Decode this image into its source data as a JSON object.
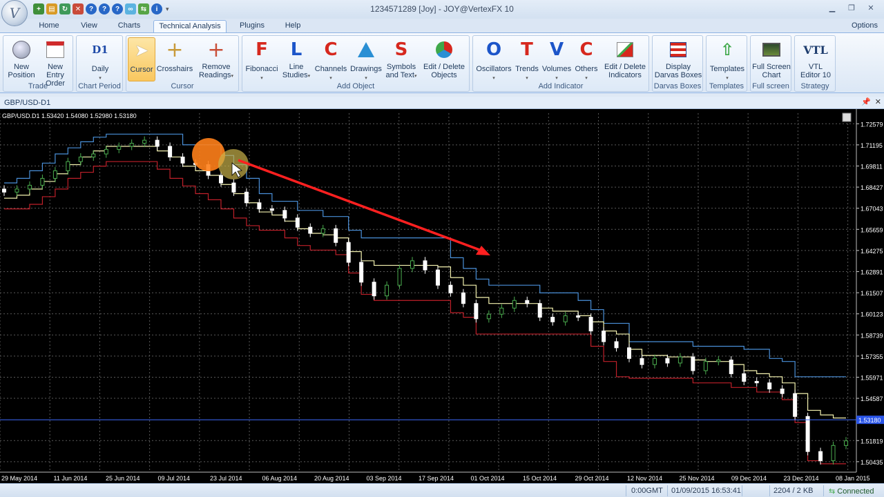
{
  "window": {
    "title": "1234571289 [Joy] - JOY@VertexFX 10",
    "logo_letter": "V",
    "quick_access": [
      "new-icon",
      "open-icon",
      "refresh-icon",
      "tools-icon",
      "help-icon",
      "help-icon",
      "help-icon",
      "link-icon",
      "connection-icon",
      "info-icon"
    ],
    "dropdown": "▾"
  },
  "menu": {
    "tabs": [
      {
        "label": "Home"
      },
      {
        "label": "View"
      },
      {
        "label": "Charts"
      },
      {
        "label": "Technical Analysis"
      },
      {
        "label": "Plugins"
      },
      {
        "label": "Help"
      }
    ],
    "options": "Options"
  },
  "ribbon": {
    "groups": [
      {
        "label": "Trade",
        "buttons": [
          {
            "l1": "New",
            "l2": "Position",
            "icon": "new-position-icon"
          },
          {
            "l1": "New Entry",
            "l2": "Order",
            "icon": "new-entry-order-icon"
          }
        ]
      },
      {
        "label": "Chart Period",
        "buttons": [
          {
            "l1": "Daily",
            "l2": "",
            "glyph": "D1",
            "icon": "daily-period-icon"
          }
        ]
      },
      {
        "label": "Cursor",
        "buttons": [
          {
            "l1": "Cursor",
            "l2": "",
            "icon": "cursor-icon"
          },
          {
            "l1": "Crosshairs",
            "l2": "",
            "icon": "crosshairs-icon"
          },
          {
            "l1": "Remove",
            "l2": "Readings",
            "icon": "remove-readings-icon"
          }
        ]
      },
      {
        "label": "Add Object",
        "buttons": [
          {
            "l1": "Fibonacci",
            "l2": "",
            "glyph": "F",
            "icon": "fibonacci-icon"
          },
          {
            "l1": "Line",
            "l2": "Studies",
            "glyph": "L",
            "icon": "line-studies-icon"
          },
          {
            "l1": "Channels",
            "l2": "",
            "glyph": "C",
            "icon": "channels-icon"
          },
          {
            "l1": "Drawings",
            "l2": "",
            "icon": "drawings-icon"
          },
          {
            "l1": "Symbols",
            "l2": "and Text",
            "glyph": "S",
            "icon": "symbols-text-icon"
          },
          {
            "l1": "Edit / Delete",
            "l2": "Objects",
            "icon": "edit-objects-icon"
          }
        ]
      },
      {
        "label": "Add Indicator",
        "buttons": [
          {
            "l1": "Oscillators",
            "l2": "",
            "glyph": "O",
            "icon": "oscillators-icon"
          },
          {
            "l1": "Trends",
            "l2": "",
            "glyph": "T",
            "icon": "trends-icon"
          },
          {
            "l1": "Volumes",
            "l2": "",
            "glyph": "V",
            "icon": "volumes-icon"
          },
          {
            "l1": "Others",
            "l2": "",
            "glyph": "C",
            "icon": "others-icon"
          },
          {
            "l1": "Edit / Delete",
            "l2": "Indicators",
            "icon": "edit-indicators-icon"
          }
        ]
      },
      {
        "label": "Darvas Boxes",
        "buttons": [
          {
            "l1": "Display",
            "l2": "Darvas Boxes",
            "icon": "darvas-boxes-icon"
          }
        ]
      },
      {
        "label": "Templates",
        "buttons": [
          {
            "l1": "Templates",
            "l2": "",
            "icon": "templates-icon"
          }
        ]
      },
      {
        "label": "Full screen",
        "buttons": [
          {
            "l1": "Full Screen",
            "l2": "Chart",
            "icon": "full-screen-icon"
          }
        ]
      },
      {
        "label": "Strategy",
        "buttons": [
          {
            "l1": "VTL",
            "l2": "Editor 10",
            "glyph": "VTL",
            "icon": "vtl-editor-icon"
          }
        ]
      }
    ]
  },
  "chart_tab": {
    "label": "GBP/USD-D1",
    "pin": "📌",
    "close": "✕"
  },
  "chart_data": {
    "type": "candlestick",
    "ohlc_label": "GBP/USD.D1  1.53420  1.54080  1.52980  1.53180",
    "yticks": [
      "1.72579",
      "1.71195",
      "1.69811",
      "1.68427",
      "1.67043",
      "1.65659",
      "1.64275",
      "1.62891",
      "1.61507",
      "1.60123",
      "1.58739",
      "1.57355",
      "1.55971",
      "1.54587",
      "1.53180",
      "1.51819",
      "1.50435"
    ],
    "ylim": [
      1.4975,
      1.7327
    ],
    "current_price": "1.53180",
    "xticks": [
      "29 May 2014",
      "11 Jun 2014",
      "25 Jun 2014",
      "09 Jul 2014",
      "23 Jul 2014",
      "06 Aug 2014",
      "20 Aug 2014",
      "03 Sep 2014",
      "17 Sep 2014",
      "01 Oct 2014",
      "15 Oct 2014",
      "29 Oct 2014",
      "12 Nov 2014",
      "25 Nov 2014",
      "09 Dec 2014",
      "23 Dec 2014",
      "08 Jan 2015"
    ],
    "colors": {
      "background": "#000000",
      "grid": "#5a5a5a",
      "bull": "#4caf50",
      "bear": "#ffffff",
      "upper": "#4a90d9",
      "middle": "#f5f3b0",
      "lower": "#c0202a",
      "current_line": "#3f6cff",
      "arrow": "#ff2020",
      "highlight": "#ff7f1a"
    },
    "closes": [
      1.681,
      1.683,
      1.6855,
      1.69,
      1.695,
      1.701,
      1.704,
      1.706,
      1.709,
      1.711,
      1.713,
      1.715,
      1.711,
      1.704,
      1.7,
      1.699,
      1.692,
      1.687,
      1.681,
      1.674,
      1.67,
      1.669,
      1.664,
      1.658,
      1.654,
      1.657,
      1.648,
      1.635,
      1.622,
      1.613,
      1.62,
      1.631,
      1.636,
      1.63,
      1.62,
      1.615,
      1.608,
      1.598,
      1.601,
      1.605,
      1.61,
      1.608,
      1.599,
      1.596,
      1.6,
      1.599,
      1.59,
      1.583,
      1.579,
      1.572,
      1.568,
      1.572,
      1.569,
      1.573,
      1.564,
      1.57,
      1.571,
      1.562,
      1.557,
      1.556,
      1.552,
      1.549,
      1.534,
      1.511,
      1.505,
      1.515,
      1.518
    ],
    "upper_band": [
      1.687,
      1.69,
      1.695,
      1.7,
      1.706,
      1.71,
      1.714,
      1.717,
      1.719,
      1.719,
      1.719,
      1.719,
      1.719,
      1.719,
      1.712,
      1.712,
      1.712,
      1.705,
      1.699,
      1.69,
      1.68,
      1.675,
      1.675,
      1.669,
      1.669,
      1.665,
      1.665,
      1.656,
      1.651,
      1.651,
      1.651,
      1.651,
      1.651,
      1.651,
      1.651,
      1.638,
      1.631,
      1.624,
      1.62,
      1.62,
      1.62,
      1.62,
      1.615,
      1.615,
      1.615,
      1.61,
      1.604,
      1.595,
      1.595,
      1.583,
      1.583,
      1.583,
      1.583,
      1.583,
      1.58,
      1.58,
      1.58,
      1.58,
      1.578,
      1.578,
      1.572,
      1.57,
      1.56,
      1.56,
      1.56,
      1.56,
      1.56
    ],
    "middle_band": [
      1.677,
      1.679,
      1.683,
      1.688,
      1.693,
      1.699,
      1.704,
      1.708,
      1.711,
      1.711,
      1.711,
      1.711,
      1.708,
      1.704,
      1.698,
      1.695,
      1.692,
      1.686,
      1.68,
      1.674,
      1.668,
      1.666,
      1.662,
      1.657,
      1.654,
      1.653,
      1.651,
      1.642,
      1.636,
      1.633,
      1.633,
      1.633,
      1.633,
      1.633,
      1.632,
      1.625,
      1.62,
      1.612,
      1.608,
      1.608,
      1.608,
      1.608,
      1.605,
      1.603,
      1.603,
      1.6,
      1.596,
      1.59,
      1.588,
      1.578,
      1.574,
      1.574,
      1.573,
      1.573,
      1.571,
      1.57,
      1.57,
      1.568,
      1.564,
      1.562,
      1.56,
      1.556,
      1.549,
      1.538,
      1.535,
      1.533,
      1.533
    ],
    "lower_band": [
      1.67,
      1.67,
      1.673,
      1.678,
      1.683,
      1.69,
      1.694,
      1.698,
      1.701,
      1.701,
      1.701,
      1.701,
      1.696,
      1.69,
      1.685,
      1.68,
      1.676,
      1.67,
      1.664,
      1.659,
      1.656,
      1.656,
      1.651,
      1.646,
      1.643,
      1.643,
      1.64,
      1.628,
      1.614,
      1.61,
      1.61,
      1.61,
      1.61,
      1.61,
      1.61,
      1.602,
      1.599,
      1.588,
      1.588,
      1.588,
      1.588,
      1.588,
      1.588,
      1.588,
      1.588,
      1.588,
      1.58,
      1.57,
      1.56,
      1.559,
      1.559,
      1.559,
      1.559,
      1.559,
      1.556,
      1.556,
      1.556,
      1.553,
      1.553,
      1.55,
      1.55,
      1.545,
      1.53,
      1.505,
      1.503,
      1.503,
      1.503
    ]
  },
  "status": {
    "gmt": "0:00GMT",
    "datetime": "01/09/2015 16:53:41",
    "traffic": "2204 / 2 KB",
    "connection": "Connected"
  }
}
